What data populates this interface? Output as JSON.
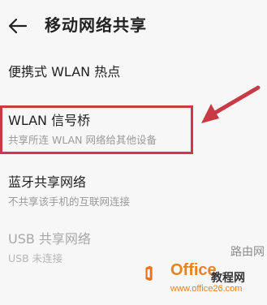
{
  "header": {
    "back_icon": "arrow-left-icon",
    "title": "移动网络共享"
  },
  "items": [
    {
      "title": "便携式 WLAN 热点",
      "subtitle": ""
    },
    {
      "title": "WLAN 信号桥",
      "subtitle": "共享所连 WLAN 网络给其他设备"
    },
    {
      "title": "蓝牙共享网络",
      "subtitle": "不共享该手机的互联网连接"
    },
    {
      "title": "USB 共享网络",
      "subtitle": "USB 未连接",
      "disabled": true
    }
  ],
  "annotation": {
    "color": "#c93a45"
  },
  "watermark": {
    "brand": "Office",
    "brand_cn": "教程网",
    "url": "www.office26.com",
    "overlay": "路由网",
    "logo_icon": "office-logo-icon",
    "logo_color": "#e8741f"
  }
}
